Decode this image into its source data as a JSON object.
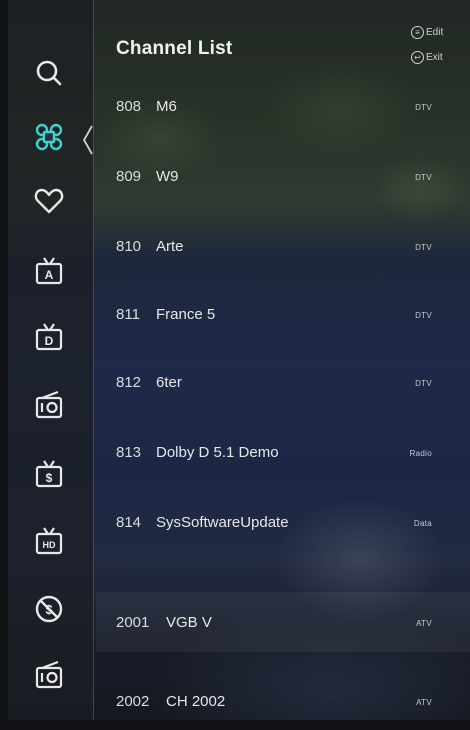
{
  "header": {
    "title": "Channel List",
    "edit_label": "Edit",
    "exit_label": "Exit"
  },
  "sidebar": {
    "items": [
      {
        "name": "search-icon",
        "active": false
      },
      {
        "name": "channels-icon",
        "active": true
      },
      {
        "name": "favorite-heart-icon",
        "active": false
      },
      {
        "name": "tv-a-icon",
        "active": false
      },
      {
        "name": "tv-d-icon",
        "active": false
      },
      {
        "name": "radio-icon",
        "active": false
      },
      {
        "name": "tv-paid-icon",
        "active": false
      },
      {
        "name": "tv-hd-icon",
        "active": false
      },
      {
        "name": "free-channel-icon",
        "active": false
      },
      {
        "name": "radio-icon-2",
        "active": false
      }
    ],
    "accent_color": "#3fd3d0"
  },
  "channels": [
    {
      "number": "808",
      "name": "M6",
      "type": "DTV"
    },
    {
      "number": "809",
      "name": "W9",
      "type": "DTV"
    },
    {
      "number": "810",
      "name": "Arte",
      "type": "DTV"
    },
    {
      "number": "811",
      "name": "France 5",
      "type": "DTV"
    },
    {
      "number": "812",
      "name": "6ter",
      "type": "DTV"
    },
    {
      "number": "813",
      "name": "Dolby D 5.1 Demo",
      "type": "Radio"
    },
    {
      "number": "814",
      "name": "SysSoftwareUpdate",
      "type": "Data"
    },
    {
      "number": "2001",
      "name": "VGB V",
      "type": "ATV"
    },
    {
      "number": "2002",
      "name": "CH 2002",
      "type": "ATV"
    }
  ]
}
